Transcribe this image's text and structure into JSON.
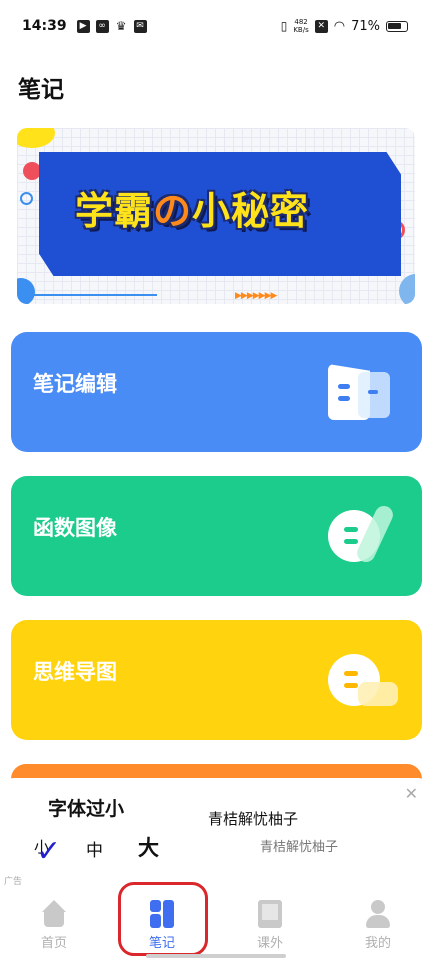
{
  "status": {
    "time": "14:39",
    "net_speed_value": "482",
    "net_speed_unit": "KB/s",
    "battery": "71%"
  },
  "page": {
    "title": "笔记"
  },
  "banner": {
    "text_a": "学霸",
    "text_no": "の",
    "text_b": "小秘密"
  },
  "cards": [
    {
      "label": "笔记编辑",
      "color": "#4a8cf6",
      "icon": "document-icon"
    },
    {
      "label": "函数图像",
      "color": "#1bcc8c",
      "icon": "chat-bubble-icon"
    },
    {
      "label": "思维导图",
      "color": "#ffd40f",
      "icon": "chat-bubble-icon"
    }
  ],
  "popup": {
    "title": "字体过小",
    "option_small": "小",
    "option_medium": "中",
    "option_large": "大",
    "ad_title": "青桔解忧柚子",
    "ad_subtitle": "青桔解忧柚子",
    "ad_tag": "广告"
  },
  "tabs": [
    {
      "label": "首页",
      "icon": "home-icon"
    },
    {
      "label": "笔记",
      "icon": "notes-icon",
      "active": true
    },
    {
      "label": "课外",
      "icon": "book-icon"
    },
    {
      "label": "我的",
      "icon": "user-icon"
    }
  ],
  "colors": {
    "accent": "#3f6ff0",
    "highlight": "#d9272b"
  }
}
